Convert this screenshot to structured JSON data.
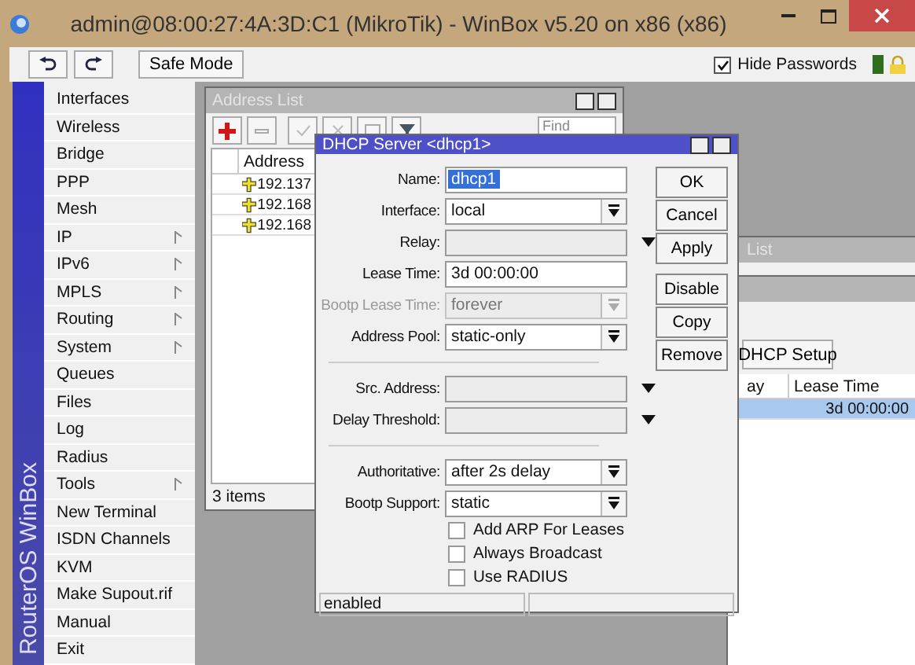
{
  "window": {
    "title": "admin@08:00:27:4A:3D:C1 (MikroTik) - WinBox v5.20 on x86 (x86)"
  },
  "toolbar": {
    "safe_mode": "Safe Mode",
    "hide_passwords": {
      "label": "Hide Passwords",
      "checked": true
    }
  },
  "sidebar": {
    "brand": "RouterOS WinBox",
    "items": [
      {
        "label": "Interfaces",
        "has_submenu": false
      },
      {
        "label": "Wireless",
        "has_submenu": false
      },
      {
        "label": "Bridge",
        "has_submenu": false
      },
      {
        "label": "PPP",
        "has_submenu": false
      },
      {
        "label": "Mesh",
        "has_submenu": false
      },
      {
        "label": "IP",
        "has_submenu": true
      },
      {
        "label": "IPv6",
        "has_submenu": true
      },
      {
        "label": "MPLS",
        "has_submenu": true
      },
      {
        "label": "Routing",
        "has_submenu": true
      },
      {
        "label": "System",
        "has_submenu": true
      },
      {
        "label": "Queues",
        "has_submenu": false
      },
      {
        "label": "Files",
        "has_submenu": false
      },
      {
        "label": "Log",
        "has_submenu": false
      },
      {
        "label": "Radius",
        "has_submenu": false
      },
      {
        "label": "Tools",
        "has_submenu": true
      },
      {
        "label": "New Terminal",
        "has_submenu": false
      },
      {
        "label": "ISDN Channels",
        "has_submenu": false
      },
      {
        "label": "KVM",
        "has_submenu": false
      },
      {
        "label": "Make Supout.rif",
        "has_submenu": false
      },
      {
        "label": "Manual",
        "has_submenu": false
      },
      {
        "label": "Exit",
        "has_submenu": false
      }
    ]
  },
  "address_list": {
    "title": "Address List",
    "find_placeholder": "Find",
    "columns": [
      "Address"
    ],
    "rows": [
      {
        "address": "192.137"
      },
      {
        "address": "192.168"
      },
      {
        "address": "192.168"
      }
    ],
    "status": "3 items"
  },
  "dhcp_server_dialog": {
    "title": "DHCP Server <dhcp1>",
    "field_groups": [
      [
        {
          "label": "Name:",
          "kind": "text",
          "value": "dhcp1",
          "highlighted": true,
          "disabled": false
        },
        {
          "label": "Interface:",
          "kind": "select",
          "value": "local",
          "highlighted": false,
          "disabled": false
        },
        {
          "label": "Relay:",
          "kind": "combo",
          "disabled": false
        },
        {
          "label": "Lease Time:",
          "kind": "text",
          "value": "3d 00:00:00",
          "highlighted": false,
          "disabled": false
        },
        {
          "label": "Bootp Lease Time:",
          "kind": "select",
          "value": "forever",
          "highlighted": false,
          "disabled": true
        },
        {
          "label": "Address Pool:",
          "kind": "select",
          "value": "static-only",
          "highlighted": false,
          "disabled": false
        }
      ],
      [
        {
          "label": "Src. Address:",
          "kind": "combo",
          "disabled": false
        },
        {
          "label": "Delay Threshold:",
          "kind": "combo",
          "disabled": false
        }
      ],
      [
        {
          "label": "Authoritative:",
          "kind": "select",
          "value": "after 2s delay",
          "highlighted": false,
          "disabled": false
        },
        {
          "label": "Bootp Support:",
          "kind": "select",
          "value": "static",
          "highlighted": false,
          "disabled": false
        }
      ]
    ],
    "checkboxes": [
      {
        "label": "Add ARP For Leases",
        "checked": false
      },
      {
        "label": "Always Broadcast",
        "checked": false
      },
      {
        "label": "Use RADIUS",
        "checked": false
      }
    ],
    "button_groups": [
      [
        "OK",
        "Cancel",
        "Apply"
      ],
      [
        "Disable",
        "Copy",
        "Remove"
      ]
    ],
    "status": "enabled"
  },
  "background_windows": [
    {
      "title": "List"
    },
    {
      "button": "DHCP Setup",
      "columns": [
        "ay",
        "Lease Time"
      ],
      "rows": [
        {
          "cells": [
            "",
            "3d 00:00:00"
          ],
          "selected": true
        }
      ]
    }
  ]
}
